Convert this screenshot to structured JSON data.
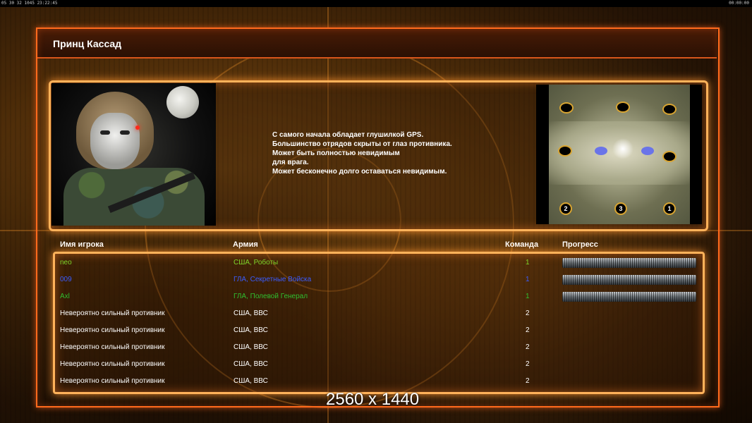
{
  "topbar": {
    "left": "05 30 32 1045 23:22:45",
    "right": "00:00:00"
  },
  "title": "Принц Кассад",
  "description_lines": [
    "С самого начала обладает глушилкой GPS.",
    "Большинство отрядов скрыты от глаз противника.",
    "Может быть полностью невидимым",
    "для врага.",
    "Может бесконечно долго оставаться невидимым."
  ],
  "minimap": {
    "spawn_numbers": [
      "2",
      "3",
      "1"
    ]
  },
  "table": {
    "headers": {
      "player": "Имя игрока",
      "army": "Армия",
      "team": "Команда",
      "progress": "Прогресс"
    },
    "rows": [
      {
        "name": "neo",
        "army": "США, Роботы",
        "team": "1",
        "color": "#7ed62a",
        "progress": 1.0
      },
      {
        "name": "009",
        "army": "ГЛА, Секретные Войска",
        "team": "1",
        "color": "#3a5cff",
        "progress": 1.0
      },
      {
        "name": "Axl",
        "army": "ГЛА, Полевой Генерал",
        "team": "1",
        "color": "#2fbf2f",
        "progress": 1.0
      },
      {
        "name": "Невероятно сильный противник",
        "army": "США, ВВС",
        "team": "2",
        "color": "#ffffff"
      },
      {
        "name": "Невероятно сильный противник",
        "army": "США, ВВС",
        "team": "2",
        "color": "#ffffff"
      },
      {
        "name": "Невероятно сильный противник",
        "army": "США, ВВС",
        "team": "2",
        "color": "#ffffff"
      },
      {
        "name": "Невероятно сильный противник",
        "army": "США, ВВС",
        "team": "2",
        "color": "#ffffff"
      },
      {
        "name": "Невероятно сильный противник",
        "army": "США, ВВС",
        "team": "2",
        "color": "#ffffff"
      }
    ]
  },
  "resolution_label": "2560 x 1440",
  "colors": {
    "frame_orange": "#ff6a1c",
    "panel_glow": "#ffb25a"
  }
}
